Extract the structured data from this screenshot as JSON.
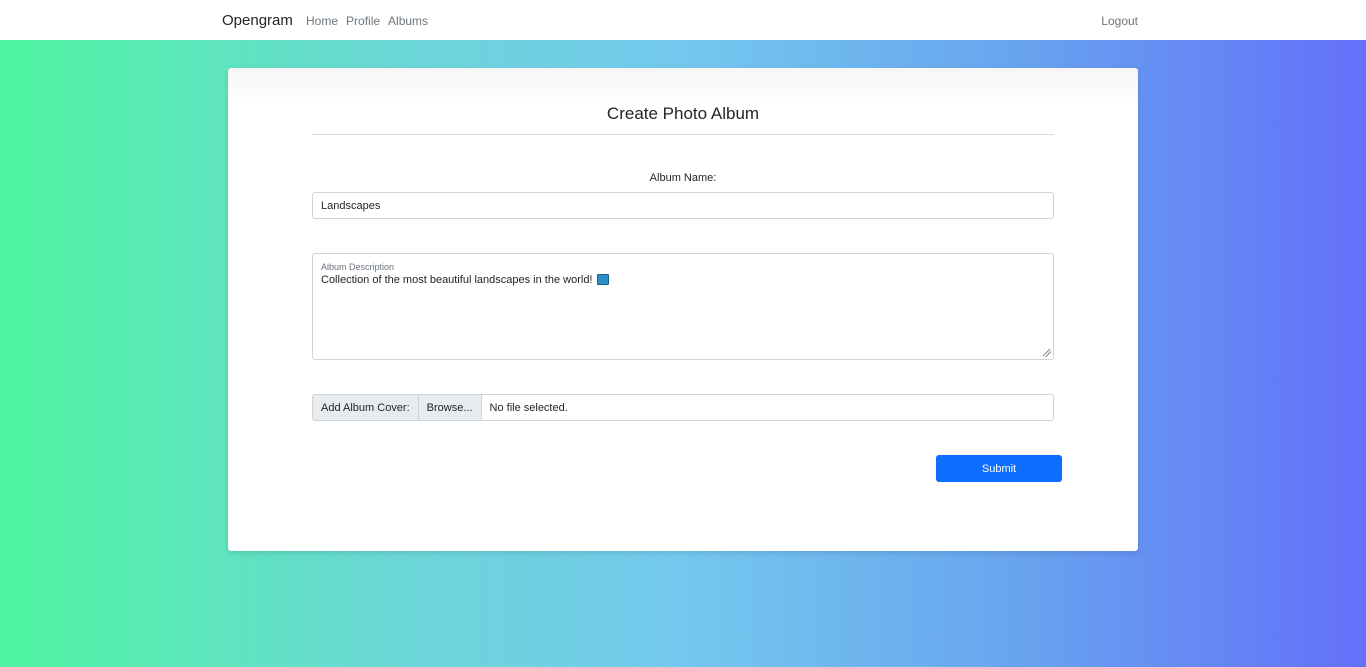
{
  "nav": {
    "brand": "Opengram",
    "links": [
      "Home",
      "Profile",
      "Albums"
    ],
    "logout": "Logout"
  },
  "form": {
    "title": "Create Photo Album",
    "album_name_label": "Album Name:",
    "album_name_value": "Landscapes",
    "description_label": "Album Description",
    "description_value": "Collection of the most beautiful landscapes in the world!",
    "description_icon": "world-map-icon",
    "cover_label": "Add Album Cover:",
    "browse_label": "Browse...",
    "file_status": "No file selected.",
    "submit_label": "Submit"
  },
  "colors": {
    "accent": "#0d6efd",
    "gradient_start": "#4ff5a1",
    "gradient_end": "#6370fa"
  }
}
